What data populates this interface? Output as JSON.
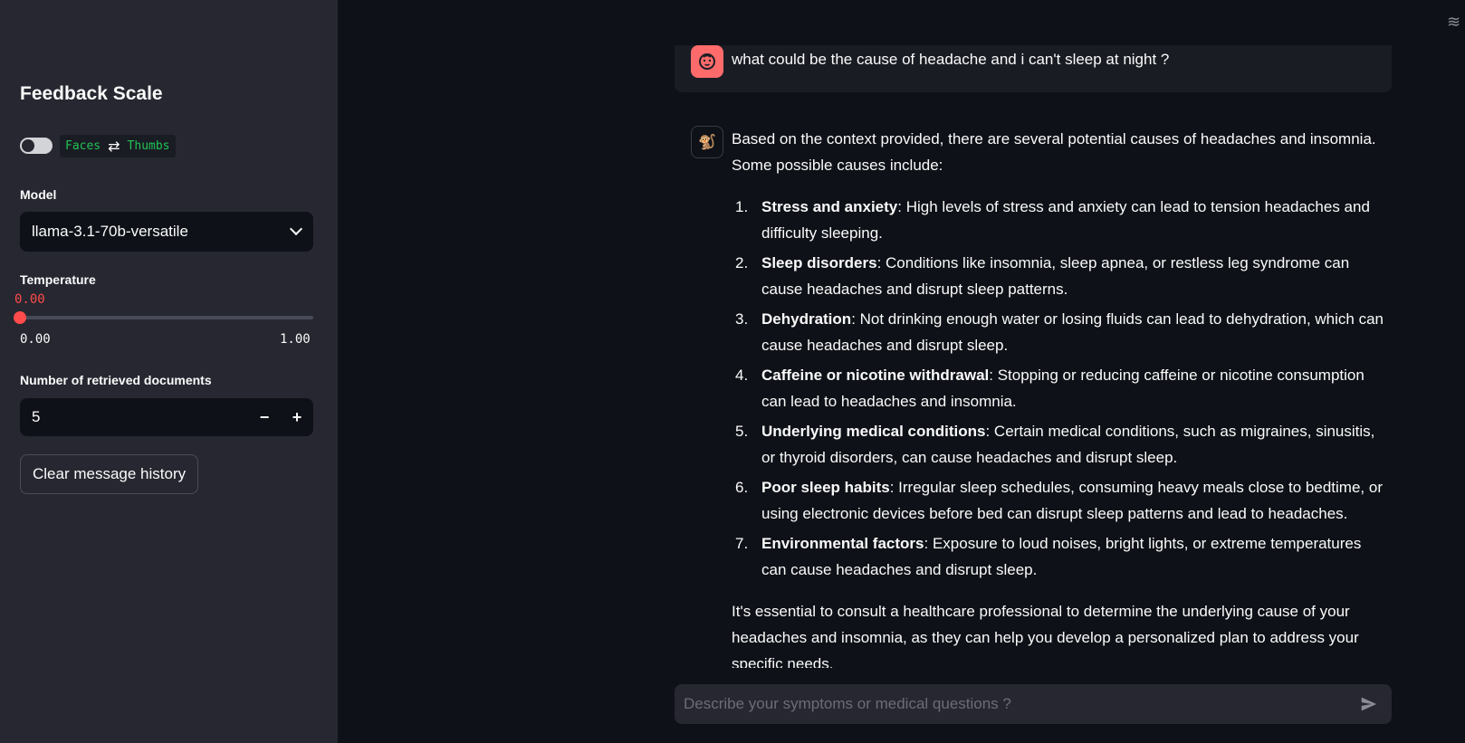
{
  "sidebar": {
    "title": "Feedback Scale",
    "feedback_toggle": {
      "on": false,
      "option_left": "Faces",
      "arrows": "⇄",
      "option_right": "Thumbs"
    },
    "model": {
      "label": "Model",
      "selected": "llama-3.1-70b-versatile"
    },
    "temperature": {
      "label": "Temperature",
      "value": "0.00",
      "min": "0.00",
      "max": "1.00",
      "fraction": 0.0
    },
    "num_docs": {
      "label": "Number of retrieved documents",
      "value": "5",
      "minus": "−",
      "plus": "+"
    },
    "clear_button": "Clear message history"
  },
  "chat": {
    "user_message": "what could be the cause of headache and i can't sleep at night ?",
    "user_avatar_icon": "face-icon",
    "bot_avatar_icon": "monkey-icon",
    "bot_avatar_glyph": "🐒",
    "bot_intro": "Based on the context provided, there are several potential causes of headaches and insomnia. Some possible causes include:",
    "bot_items": [
      {
        "num": "1.",
        "title": "Stress and anxiety",
        "text": ": High levels of stress and anxiety can lead to tension headaches and difficulty sleeping."
      },
      {
        "num": "2.",
        "title": "Sleep disorders",
        "text": ": Conditions like insomnia, sleep apnea, or restless leg syndrome can cause headaches and disrupt sleep patterns."
      },
      {
        "num": "3.",
        "title": "Dehydration",
        "text": ": Not drinking enough water or losing fluids can lead to dehydration, which can cause headaches and disrupt sleep."
      },
      {
        "num": "4.",
        "title": "Caffeine or nicotine withdrawal",
        "text": ": Stopping or reducing caffeine or nicotine consumption can lead to headaches and insomnia."
      },
      {
        "num": "5.",
        "title": "Underlying medical conditions",
        "text": ": Certain medical conditions, such as migraines, sinusitis, or thyroid disorders, can cause headaches and disrupt sleep."
      },
      {
        "num": "6.",
        "title": "Poor sleep habits",
        "text": ": Irregular sleep schedules, consuming heavy meals close to bedtime, or using electronic devices before bed can disrupt sleep patterns and lead to headaches."
      },
      {
        "num": "7.",
        "title": "Environmental factors",
        "text": ": Exposure to loud noises, bright lights, or extreme temperatures can cause headaches and disrupt sleep."
      }
    ],
    "bot_closing": "It's essential to consult a healthcare professional to determine the underlying cause of your headaches and insomnia, as they can help you develop a personalized plan to address your specific needs.",
    "input_placeholder": "Describe your symptoms or medical questions ?"
  },
  "colors": {
    "accent": "#ff4b4b",
    "code_green": "#21c354",
    "sidebar_bg": "#262730",
    "main_bg": "#0e1117"
  }
}
